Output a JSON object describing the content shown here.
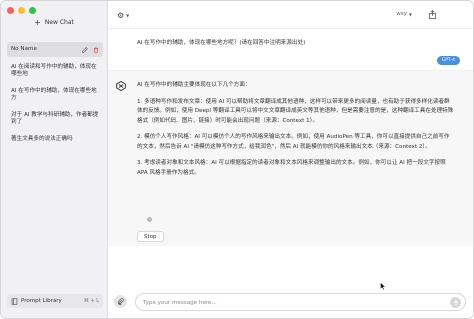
{
  "sidebar": {
    "new_chat_label": "New Chat",
    "chats": [
      {
        "label": "No Name",
        "active": true
      },
      {
        "label": "AI 在阅读和写作中的辅助，体现在哪些地",
        "active": false
      },
      {
        "label": "AI 在写作中的辅助，体现在哪些地方",
        "active": false
      },
      {
        "label": "对于 AI 教学与科研辅助，作者都提到了",
        "active": false
      },
      {
        "label": "著生文具多的说法正确吗",
        "active": false
      }
    ],
    "prompt_library_label": "Prompt Library",
    "prompt_library_shortcut": "⌘ + L"
  },
  "topbar": {
    "user_label": "wsy"
  },
  "conversation": {
    "user_message": "AI 在写作中的辅助，体现在哪些地方呢？(请在回答中注明来源出处)",
    "model_tag": "GPT-4",
    "answer_paragraphs": [
      "AI 在写作中的辅助主要体现在以下几个方面：",
      "1. 多语种写作和发布文章：使用 AI 可以帮助将文章翻译成其他语种，这样可以带来更多的阅读量，也有助于获得多样化读者群体的反馈。例如，使用 Deepl 等翻译工具可以将中文文章翻译成英文等其他语种，但是需要注意的是，这种翻译工具在处理特殊格式（例如代码、图片、链接）时可能会出现问题（来源：Context 1）。",
      "2. 模仿个人写作风格：AI 可以模仿个人的写作风格来输出文本。例如，使用 AudioPen 等工具，你可以直接提供自己之前写作的文本，然后告诉 AI \"请模仿这种写作方式，给我润色\"，然后 AI 就能模仿你的风格来输出文本（来源：Context 2）。",
      "3. 考虑读者对象和文本风格：AI 可以根据指定的读者对象和文本风格来调整输出的文本。例如，你可以让 AI 把一段文字按照 APA 风格手册作为格式。"
    ],
    "stop_label": "Stop"
  },
  "input": {
    "placeholder": "Type your message here..."
  },
  "colors": {
    "accent": "#4a90e2",
    "sidebar_bg": "#f1f1f3",
    "answer_bg": "#f7f7f8"
  }
}
